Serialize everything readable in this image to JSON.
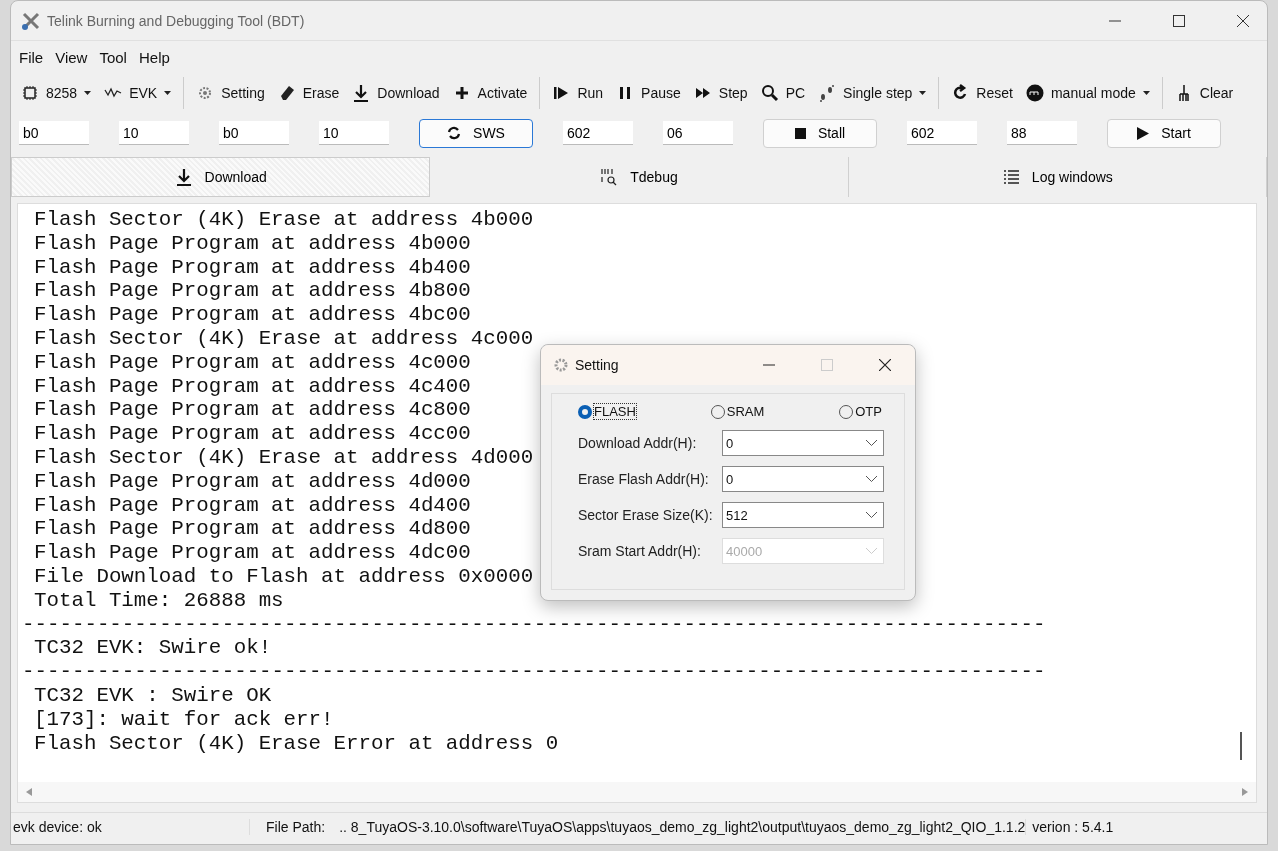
{
  "window": {
    "title": "Telink Burning and Debugging Tool (BDT)"
  },
  "menu": [
    "File",
    "View",
    "Tool",
    "Help"
  ],
  "toolbar": [
    {
      "label": "8258",
      "dropdown": true
    },
    {
      "label": "EVK",
      "dropdown": true
    },
    {
      "kind": "separator"
    },
    {
      "label": "Setting",
      "dropdown": false
    },
    {
      "label": "Erase",
      "dropdown": false
    },
    {
      "label": "Download",
      "dropdown": false
    },
    {
      "label": "Activate",
      "dropdown": false
    },
    {
      "kind": "separator"
    },
    {
      "label": "Run",
      "dropdown": false
    },
    {
      "label": "Pause",
      "dropdown": false
    },
    {
      "label": "Step",
      "dropdown": false
    },
    {
      "label": "PC",
      "dropdown": false
    },
    {
      "label": "Single step",
      "dropdown": true
    },
    {
      "kind": "separator"
    },
    {
      "label": "Reset",
      "dropdown": false
    },
    {
      "label": "manual mode",
      "dropdown": true
    },
    {
      "kind": "separator"
    },
    {
      "label": "Clear",
      "dropdown": false
    }
  ],
  "controls": [
    {
      "kind": "field",
      "value": "b0"
    },
    {
      "kind": "field",
      "value": "10"
    },
    {
      "kind": "field",
      "value": "b0"
    },
    {
      "kind": "field",
      "value": "10"
    },
    {
      "kind": "button",
      "label": "SWS",
      "focused": true
    },
    {
      "kind": "field",
      "value": "602"
    },
    {
      "kind": "field",
      "value": "06"
    },
    {
      "kind": "button",
      "label": "Stall",
      "focused": false
    },
    {
      "kind": "field",
      "value": "602"
    },
    {
      "kind": "field",
      "value": "88"
    },
    {
      "kind": "button",
      "label": "Start",
      "focused": false
    }
  ],
  "tabs": [
    {
      "label": "Download",
      "selected": true
    },
    {
      "label": "Tdebug",
      "selected": false
    },
    {
      "label": "Log windows",
      "selected": false
    }
  ],
  "log": [
    {
      "kind": "text",
      "text": "Flash Sector (4K) Erase at address 4b000"
    },
    {
      "kind": "text",
      "text": "Flash Page Program at address 4b000"
    },
    {
      "kind": "text",
      "text": "Flash Page Program at address 4b400"
    },
    {
      "kind": "text",
      "text": "Flash Page Program at address 4b800"
    },
    {
      "kind": "text",
      "text": "Flash Page Program at address 4bc00"
    },
    {
      "kind": "text",
      "text": "Flash Sector (4K) Erase at address 4c000"
    },
    {
      "kind": "text",
      "text": "Flash Page Program at address 4c000"
    },
    {
      "kind": "text",
      "text": "Flash Page Program at address 4c400"
    },
    {
      "kind": "text",
      "text": "Flash Page Program at address 4c800"
    },
    {
      "kind": "text",
      "text": "Flash Page Program at address 4cc00"
    },
    {
      "kind": "text",
      "text": "Flash Sector (4K) Erase at address 4d000"
    },
    {
      "kind": "text",
      "text": "Flash Page Program at address 4d000"
    },
    {
      "kind": "text",
      "text": "Flash Page Program at address 4d400"
    },
    {
      "kind": "text",
      "text": "Flash Page Program at address 4d800"
    },
    {
      "kind": "text",
      "text": "Flash Page Program at address 4dc00"
    },
    {
      "kind": "text",
      "text": "File Download to Flash at address 0x0000"
    },
    {
      "kind": "text",
      "text": "Total Time: 26888 ms"
    },
    {
      "kind": "rule",
      "text": "----------------------------------------------------------------------------------"
    },
    {
      "kind": "text",
      "text": "TC32 EVK: Swire ok!"
    },
    {
      "kind": "rule",
      "text": "----------------------------------------------------------------------------------"
    },
    {
      "kind": "text",
      "text": "TC32 EVK : Swire OK"
    },
    {
      "kind": "text",
      "text": "[173]: wait for ack err!"
    },
    {
      "kind": "text",
      "text": "Flash Sector (4K) Erase Error at address 0"
    }
  ],
  "status_bar": {
    "device": "evk device: ok",
    "path_label": "File Path:",
    "path": "..  8_TuyaOS-3.10.0\\software\\TuyaOS\\apps\\tuyaos_demo_zg_light2\\output\\tuyaos_demo_zg_light2_QIO_1.1.2",
    "version": "verion : 5.4.1"
  },
  "dialog": {
    "title": "Setting",
    "radios": [
      {
        "label": "FLASH",
        "selected": true
      },
      {
        "label": "SRAM",
        "selected": false
      },
      {
        "label": "OTP",
        "selected": false
      }
    ],
    "rows": [
      {
        "label": "Download  Addr(H):",
        "value": "0",
        "disabled": false
      },
      {
        "label": "Erase Flash Addr(H):",
        "value": "0",
        "disabled": false
      },
      {
        "label": "Sector Erase Size(K):",
        "value": "512",
        "disabled": false
      },
      {
        "label": "Sram Start Addr(H):",
        "value": "40000",
        "disabled": true
      }
    ]
  }
}
